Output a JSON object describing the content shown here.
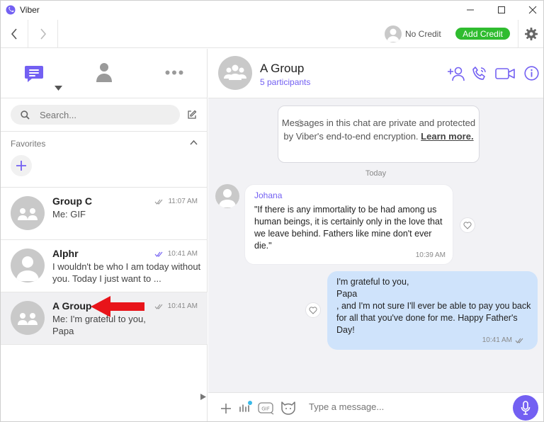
{
  "window": {
    "title": "Viber"
  },
  "toolbar": {
    "no_credit": "No Credit",
    "add_credit": "Add Credit"
  },
  "left": {
    "search_placeholder": "Search...",
    "favorites_label": "Favorites",
    "chats": [
      {
        "name": "Group C",
        "preview": "Me: GIF",
        "time": "11:07 AM"
      },
      {
        "name": "Alphr",
        "preview": "I wouldn't be who I am today without you. Today I just want to ...",
        "time": "10:41 AM"
      },
      {
        "name": "A Group",
        "preview": "Me: I'm grateful to you, Papa",
        "time": "10:41 AM"
      }
    ]
  },
  "chat": {
    "name": "A Group",
    "participants": "5 participants",
    "notice": "Messages in this chat are private and protected by Viber's end-to-end encryption.",
    "learn_more": "Learn more.",
    "day": "Today",
    "incoming": {
      "sender": "Johana",
      "text": "\"If there is any immortality to be had among us human beings, it is certainly only in the love that we leave behind. Fathers like mine don't ever die.\"",
      "time": "10:39 AM"
    },
    "outgoing": {
      "line1": "I'm grateful to you,",
      "line2": "Papa",
      "line3": ", and I'm not sure I'll ever be able to pay you back for all that you've done for me. Happy Father's Day!",
      "time": "10:41 AM"
    },
    "input_placeholder": "Type a message..."
  },
  "colors": {
    "accent": "#7360f2",
    "add_credit": "#2fbc2f",
    "outgoing_bubble": "#cfe3fb",
    "arrow": "#e8141a"
  }
}
